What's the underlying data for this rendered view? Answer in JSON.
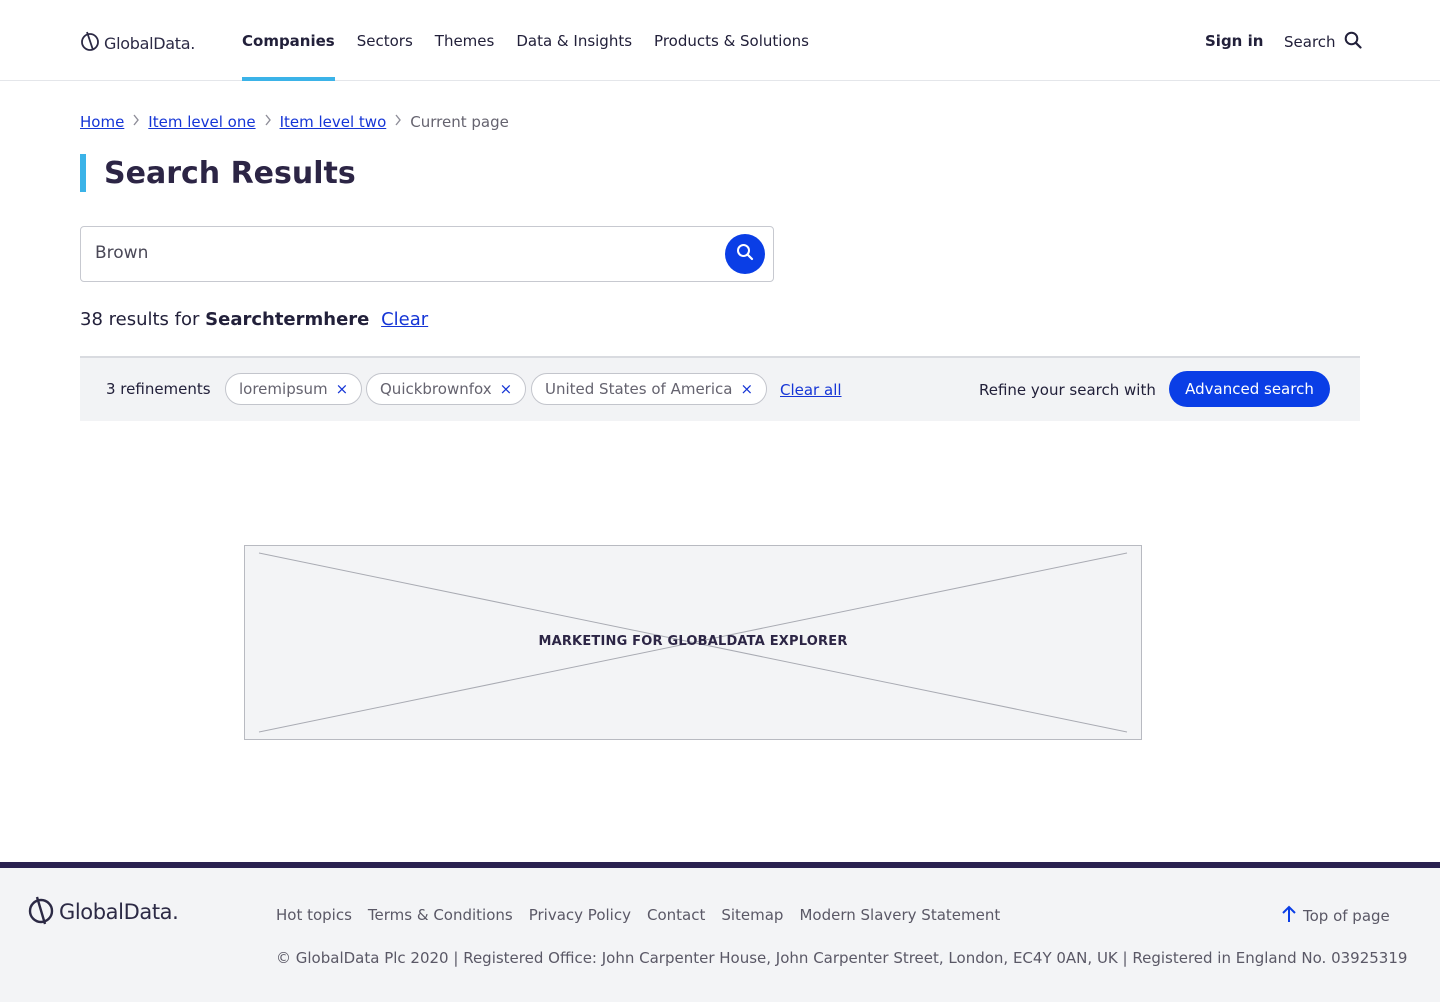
{
  "header": {
    "logo_text": "GlobalData.",
    "nav": [
      {
        "label": "Companies",
        "active": true
      },
      {
        "label": "Sectors",
        "active": false
      },
      {
        "label": "Themes",
        "active": false
      },
      {
        "label": "Data & Insights",
        "active": false
      },
      {
        "label": "Products & Solutions",
        "active": false
      }
    ],
    "sign_in": "Sign in",
    "search_label": "Search"
  },
  "breadcrumb": {
    "items": [
      "Home",
      "Item level one",
      "Item level two"
    ],
    "current": "Current page"
  },
  "page_title": "Search Results",
  "search": {
    "value": "Brown"
  },
  "results": {
    "count_text": "38 results for",
    "term": "Searchtermhere",
    "clear_label": "Clear"
  },
  "refinements": {
    "count_label": "3 refinements",
    "chips": [
      "loremipsum",
      "Quickbrownfox",
      "United States of America"
    ],
    "remove_glyph": "×",
    "clear_all": "Clear all",
    "refine_label": "Refine your search with",
    "advanced_button": "Advanced search"
  },
  "marketing": {
    "text": "MARKETING FOR GLOBALDATA EXPLORER"
  },
  "footer": {
    "logo_text": "GlobalData.",
    "links": [
      "Hot topics",
      "Terms & Conditions",
      "Privacy Policy",
      "Contact",
      "Sitemap",
      "Modern Slavery Statement"
    ],
    "top_of_page": "Top of page",
    "copyright": "© GlobalData Plc 2020 | Registered Office: John Carpenter House, John Carpenter Street, London, EC4Y 0AN, UK | Registered in England No. 03925319"
  },
  "colors": {
    "accent": "#3bb3e8",
    "primary_blue": "#0a3ee6",
    "link_blue": "#1535d6",
    "footer_border": "#2a2150"
  }
}
